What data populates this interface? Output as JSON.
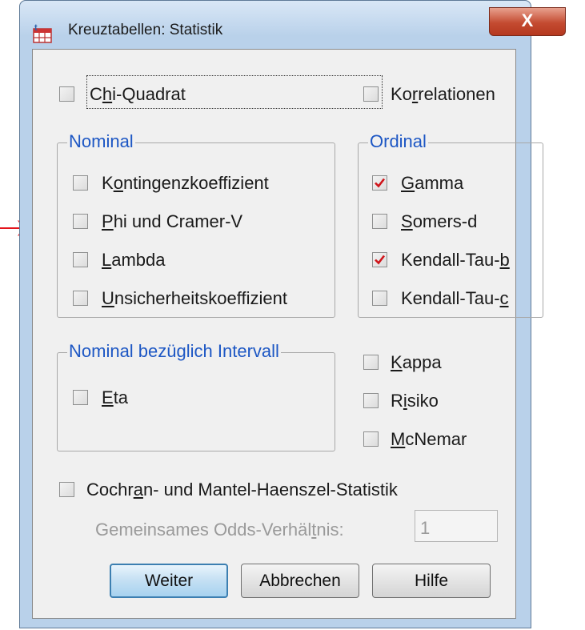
{
  "window": {
    "title": "Kreuztabellen: Statistik",
    "close_symbol": "X"
  },
  "checkboxes": {
    "chi_quadrat": {
      "label_pre": "C",
      "label_u": "h",
      "label_post": "i-Quadrat",
      "checked": false
    },
    "korrelationen": {
      "label_pre": "Ko",
      "label_u": "r",
      "label_post": "relationen",
      "checked": false
    },
    "kontingenz": {
      "label_pre": "K",
      "label_u": "o",
      "label_post": "ntingenzkoeffizient",
      "checked": false
    },
    "phi": {
      "label_pre": "",
      "label_u": "P",
      "label_post": "hi und Cramer-V",
      "checked": false
    },
    "lambda": {
      "label_pre": "",
      "label_u": "L",
      "label_post": "ambda",
      "checked": false
    },
    "unsicherheit": {
      "label_pre": "",
      "label_u": "U",
      "label_post": "nsicherheitskoeffizient",
      "checked": false
    },
    "gamma": {
      "label_pre": "",
      "label_u": "G",
      "label_post": "amma",
      "checked": true
    },
    "somers": {
      "label_pre": "",
      "label_u": "S",
      "label_post": "omers-d",
      "checked": false
    },
    "kendall_b": {
      "label_pre": "Kendall-Tau-",
      "label_u": "b",
      "label_post": "",
      "checked": true
    },
    "kendall_c": {
      "label_pre": "Kendall-Tau-",
      "label_u": "c",
      "label_post": "",
      "checked": false
    },
    "eta": {
      "label_pre": "",
      "label_u": "E",
      "label_post": "ta",
      "checked": false
    },
    "kappa": {
      "label_pre": "",
      "label_u": "K",
      "label_post": "appa",
      "checked": false
    },
    "risiko": {
      "label_pre": "R",
      "label_u": "i",
      "label_post": "siko",
      "checked": false
    },
    "mcnemar": {
      "label_pre": "",
      "label_u": "M",
      "label_post": "cNemar",
      "checked": false
    },
    "cochran": {
      "label_pre": "Cochr",
      "label_u": "a",
      "label_post": "n- und Mantel-Haenszel-Statistik",
      "checked": false
    }
  },
  "groups": {
    "nominal": "Nominal",
    "ordinal": "Ordinal",
    "nominal_intervall": "Nominal bezüglich Intervall"
  },
  "odds": {
    "label_pre": "Gemeinsames Odds-Verhäl",
    "label_u": "t",
    "label_post": "nis:",
    "value": "1"
  },
  "buttons": {
    "weiter": "Weiter",
    "abbrechen": "Abbrechen",
    "hilfe": "Hilfe"
  },
  "colors": {
    "legend": "#1d57c4",
    "check": "#d0151b",
    "arrow": "#e4141c",
    "close_button": "#c44b31"
  }
}
